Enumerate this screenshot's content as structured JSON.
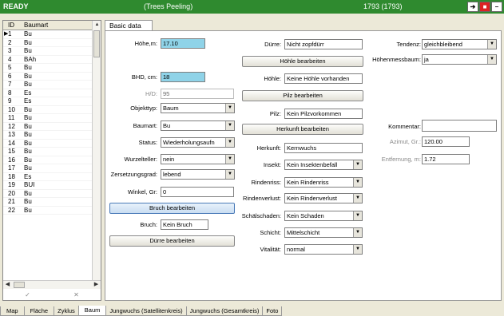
{
  "titlebar": {
    "status": "READY",
    "subtitle": "(Trees Peeling)",
    "count": "1793 (1793)",
    "btn_nav": "➔",
    "btn_max": "■",
    "btn_min": "–"
  },
  "list": {
    "columns": [
      "ID",
      "Baumart"
    ],
    "rows": [
      {
        "id": "1",
        "art": "Bu"
      },
      {
        "id": "2",
        "art": "Bu"
      },
      {
        "id": "3",
        "art": "Bu"
      },
      {
        "id": "4",
        "art": "BAh"
      },
      {
        "id": "5",
        "art": "Bu"
      },
      {
        "id": "6",
        "art": "Bu"
      },
      {
        "id": "7",
        "art": "Bu"
      },
      {
        "id": "8",
        "art": "Es"
      },
      {
        "id": "9",
        "art": "Es"
      },
      {
        "id": "10",
        "art": "Bu"
      },
      {
        "id": "11",
        "art": "Bu"
      },
      {
        "id": "12",
        "art": "Bu"
      },
      {
        "id": "13",
        "art": "Bu"
      },
      {
        "id": "14",
        "art": "Bu"
      },
      {
        "id": "15",
        "art": "Bu"
      },
      {
        "id": "16",
        "art": "Bu"
      },
      {
        "id": "17",
        "art": "Bu"
      },
      {
        "id": "18",
        "art": "Es"
      },
      {
        "id": "19",
        "art": "BUI"
      },
      {
        "id": "20",
        "art": "Bu"
      },
      {
        "id": "21",
        "art": "Bu"
      },
      {
        "id": "22",
        "art": "Bu"
      }
    ],
    "footer_check": "✓",
    "footer_x": "✕"
  },
  "top_tab": "Basic data",
  "form": {
    "hoehe_label": "Höhe,m:",
    "hoehe_value": "17.10",
    "bhd_label": "BHD, cm:",
    "bhd_value": "18",
    "hd_label": "H/D:",
    "hd_value": "95",
    "objekttyp_label": "Objekttyp:",
    "objekttyp_value": "Baum",
    "baumart_label": "Baumart:",
    "baumart_value": "Bu",
    "status_label": "Status:",
    "status_value": "Wiederholungsaufn",
    "wurzelteller_label": "Wurzelteller:",
    "wurzelteller_value": "nein",
    "zersetzung_label": "Zersetzungsgrad:",
    "zersetzung_value": "lebend",
    "winkel_label": "Winkel, Gr:",
    "winkel_value": "0",
    "bruch_btn": "Bruch bearbeiten",
    "bruch_label": "Bruch:",
    "bruch_value": "Kein Bruch",
    "duerre_btn": "Dürre bearbeiten",
    "duerre_label": "Dürre:",
    "duerre_value": "Nicht zopfdürr",
    "hoehle_btn": "Höhle bearbeiten",
    "hoehle_label": "Höhle:",
    "hoehle_value": "Keine Höhle vorhanden",
    "pilz_btn": "Pilz bearbeiten",
    "pilz_label": "Pilz:",
    "pilz_value": "Kein Pilzvorkommen",
    "herkunft_btn": "Herkunft bearbeiten",
    "herkunft_label": "Herkunft:",
    "herkunft_value": "Kernwuchs",
    "insekt_label": "Insekt:",
    "insekt_value": "Kein Insektenbefall",
    "rindenriss_label": "Rindenriss:",
    "rindenriss_value": "Kein Rindenriss",
    "rindenverlust_label": "Rindenverlust:",
    "rindenverlust_value": "Kein Rindenverlust",
    "schaelschaden_label": "Schälschaden:",
    "schaelschaden_value": "Kein Schaden",
    "schicht_label": "Schicht:",
    "schicht_value": "Mittelschicht",
    "vitalitaet_label": "Vitalität:",
    "vitalitaet_value": "normal",
    "tendenz_label": "Tendenz:",
    "tendenz_value": "gleichbleibend",
    "hoehenmess_label": "Höhenmessbaum:",
    "hoehenmess_value": "ja",
    "kommentar_label": "Kommentar:",
    "kommentar_value": "",
    "azimut_label": "Azimut, Gr.:",
    "azimut_value": "120.00",
    "entfernung_label": "Entfernung, m:",
    "entfernung_value": "1.72"
  },
  "bottom_tabs": [
    "Map",
    "Fläche",
    "Zyklus",
    "Baum",
    "Jungwuchs (Satellitenkreis)",
    "Jungwuchs (Gesamtkreis)",
    "Foto"
  ]
}
